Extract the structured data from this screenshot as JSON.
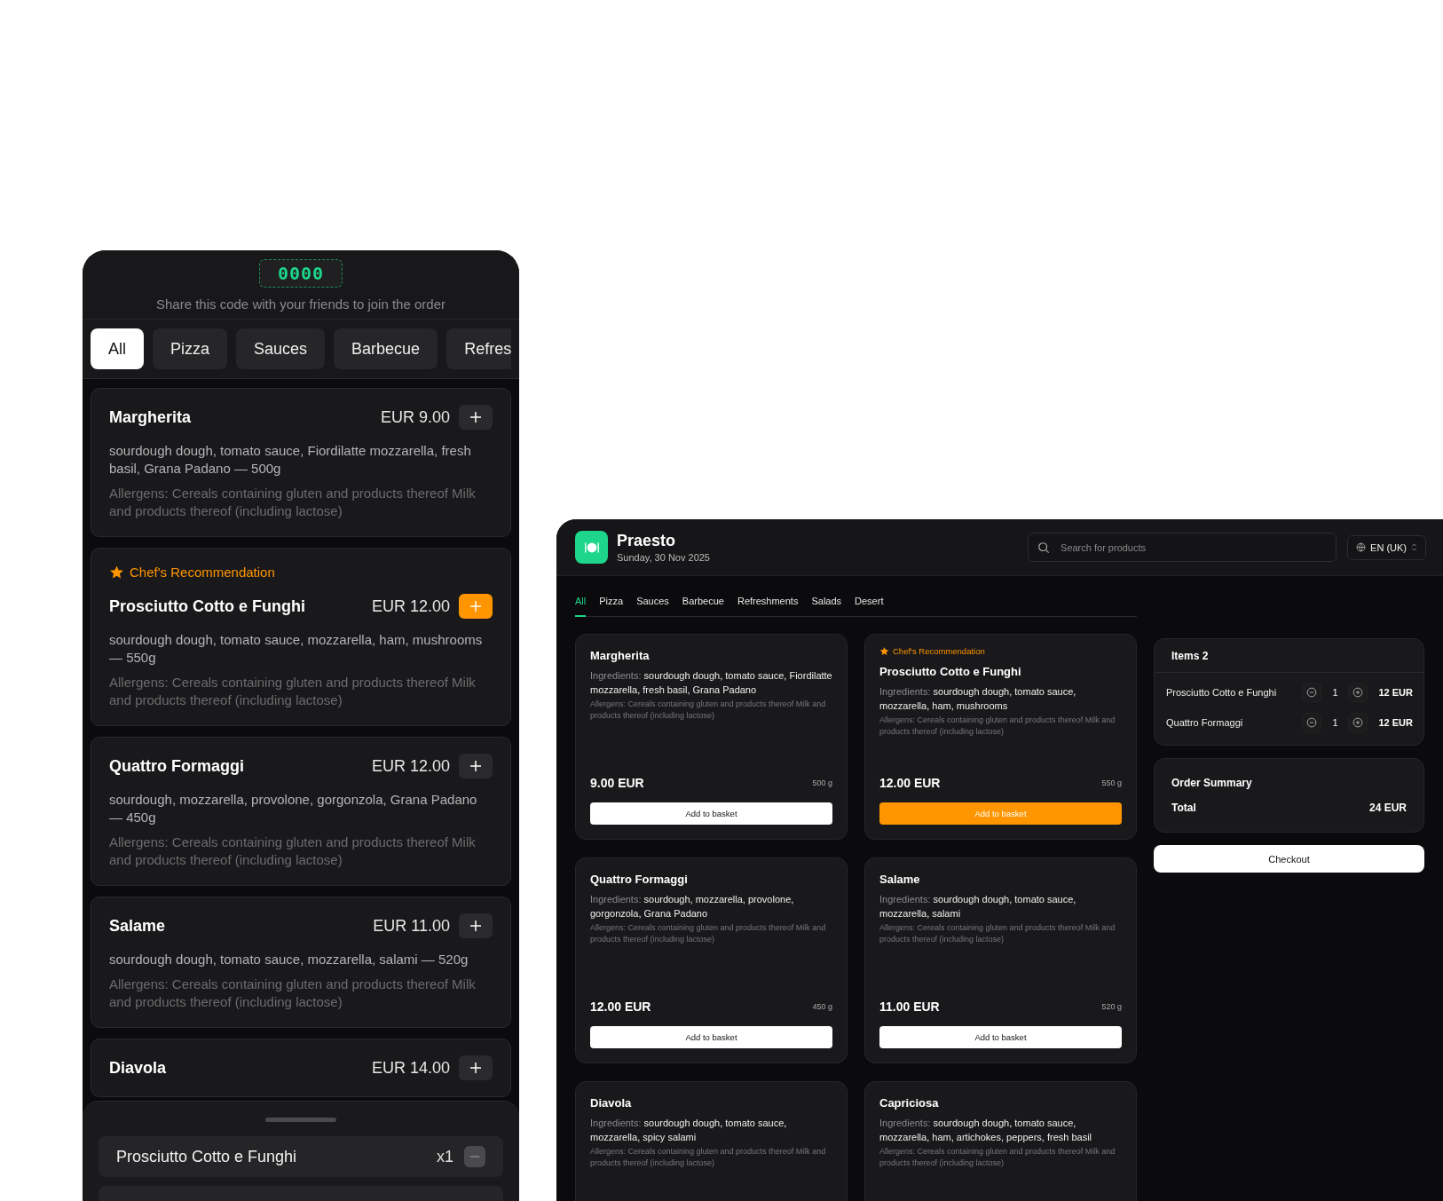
{
  "mobile": {
    "code": "0000",
    "share_text": "Share this code with your friends to join the order",
    "tabs": [
      {
        "label": "All",
        "selected": true
      },
      {
        "label": "Pizza",
        "selected": false
      },
      {
        "label": "Sauces",
        "selected": false
      },
      {
        "label": "Barbecue",
        "selected": false
      },
      {
        "label": "Refres",
        "selected": false
      }
    ],
    "products": [
      {
        "name": "Margherita",
        "price": "EUR 9.00",
        "in_basket": false,
        "description": "sourdough dough, tomato sauce, Fiordilatte mozzarella, fresh basil, Grana Padano — 500g",
        "allergens": "Allergens: Cereals containing gluten and products thereof Milk and products thereof (including lactose)"
      },
      {
        "badge": "Chef's Recommendation",
        "name": "Prosciutto Cotto e Funghi",
        "price": "EUR 12.00",
        "in_basket": true,
        "description": "sourdough dough, tomato sauce, mozzarella, ham, mushrooms — 550g",
        "allergens": "Allergens: Cereals containing gluten and products thereof Milk and products thereof (including lactose)"
      },
      {
        "name": "Quattro Formaggi",
        "price": "EUR 12.00",
        "in_basket": false,
        "description": "sourdough, mozzarella, provolone, gorgonzola, Grana Padano — 450g",
        "allergens": "Allergens: Cereals containing gluten and products thereof Milk and products thereof (including lactose)"
      },
      {
        "name": "Salame",
        "price": "EUR 11.00",
        "in_basket": false,
        "description": "sourdough dough, tomato sauce, mozzarella, salami — 520g",
        "allergens": "Allergens: Cereals containing gluten and products thereof Milk and products thereof (including lactose)"
      },
      {
        "name": "Diavola",
        "price": "EUR 14.00",
        "in_basket": false
      }
    ],
    "basket": [
      {
        "name": "Prosciutto Cotto e Funghi",
        "qty": "x1"
      }
    ]
  },
  "desktop": {
    "brand": "Praesto",
    "date": "Sunday, 30 Nov 2025",
    "search": {
      "placeholder": "Search for products"
    },
    "language": "EN (UK)",
    "tabs": [
      {
        "label": "All",
        "selected": true
      },
      {
        "label": "Pizza",
        "selected": false
      },
      {
        "label": "Sauces",
        "selected": false
      },
      {
        "label": "Barbecue",
        "selected": false
      },
      {
        "label": "Refreshments",
        "selected": false
      },
      {
        "label": "Salads",
        "selected": false
      },
      {
        "label": "Desert",
        "selected": false
      }
    ],
    "products": [
      {
        "name": "Margherita",
        "ingredients_label": "Ingredients:",
        "ingredients": "sourdough dough, tomato sauce, Fiordilatte mozzarella, fresh basil, Grana Padano",
        "allergens": "Allergens: Cereals containing gluten and products thereof Milk and products thereof (including lactose)",
        "price": "9.00 EUR",
        "weight": "500 g",
        "button": "Add to basket",
        "in_basket": false
      },
      {
        "badge": "Chef's Recommendation",
        "name": "Prosciutto Cotto e Funghi",
        "ingredients_label": "Ingredients:",
        "ingredients": "sourdough dough, tomato sauce, mozzarella, ham, mushrooms",
        "allergens": "Allergens: Cereals containing gluten and products thereof Milk and products thereof (including lactose)",
        "price": "12.00 EUR",
        "weight": "550 g",
        "button": "Add to basket",
        "in_basket": true
      },
      {
        "name": "Quattro Formaggi",
        "ingredients_label": "Ingredients:",
        "ingredients": "sourdough, mozzarella, provolone, gorgonzola, Grana Padano",
        "allergens": "Allergens: Cereals containing gluten and products thereof Milk and products thereof (including lactose)",
        "price": "12.00 EUR",
        "weight": "450 g",
        "button": "Add to basket",
        "in_basket": false
      },
      {
        "name": "Salame",
        "ingredients_label": "Ingredients:",
        "ingredients": "sourdough dough, tomato sauce, mozzarella, salami",
        "allergens": "Allergens: Cereals containing gluten and products thereof Milk and products thereof (including lactose)",
        "price": "11.00 EUR",
        "weight": "520 g",
        "button": "Add to basket",
        "in_basket": false
      },
      {
        "name": "Diavola",
        "ingredients_label": "Ingredients:",
        "ingredients": "sourdough dough, tomato sauce, mozzarella, spicy salami",
        "allergens": "Allergens: Cereals containing gluten and products thereof Milk and products thereof (including lactose)"
      },
      {
        "name": "Capriciosa",
        "ingredients_label": "Ingredients:",
        "ingredients": "sourdough dough, tomato sauce, mozzarella, ham, artichokes, peppers, fresh basil",
        "allergens": "Allergens: Cereals containing gluten and products thereof Milk and products thereof (including lactose)"
      }
    ],
    "basket": {
      "title": "Items 2",
      "items": [
        {
          "name": "Prosciutto Cotto e Funghi",
          "qty": "1",
          "price": "12 EUR"
        },
        {
          "name": "Quattro Formaggi",
          "qty": "1",
          "price": "12 EUR"
        }
      ]
    },
    "summary": {
      "title": "Order Summary",
      "total_label": "Total",
      "total": "24 EUR"
    },
    "checkout": "Checkout"
  }
}
